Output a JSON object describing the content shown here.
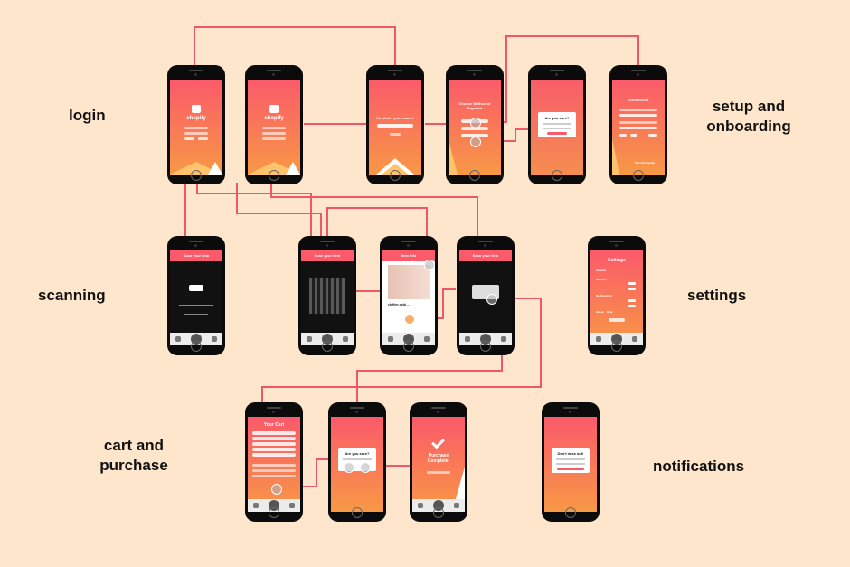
{
  "sections": {
    "login": "login",
    "setup_line1": "setup and",
    "setup_line2": "onboarding",
    "scanning": "scanning",
    "settings": "settings",
    "cart_line1": "cart and",
    "cart_line2": "purchase",
    "notifications": "notifications"
  },
  "screens": {
    "login1": {
      "brand": "shopify"
    },
    "login2": {
      "brand": "shopify"
    },
    "onboard_name": {
      "title": "Hi, what's your name?"
    },
    "onboard_payment": {
      "title": "Choose Method of Payment"
    },
    "onboard_confirm": {
      "title": "Are you sure?"
    },
    "onboard_card": {
      "title": "Credit/Debit",
      "cta": "Start Shopping!"
    },
    "scan1": {
      "title": "Scan your item"
    },
    "scan2": {
      "title": "Scan your item"
    },
    "item_info": {
      "title": "Item Info",
      "caption": "chiffon cold ..."
    },
    "scan3": {
      "title": "Scan your item"
    },
    "settings": {
      "title": "Settings",
      "rows": [
        "General",
        "Security",
        "Notifications",
        "About",
        "Help"
      ]
    },
    "cart": {
      "title": "Your Cart"
    },
    "cart_confirm": {
      "title": "Are you sure?"
    },
    "purchase_complete": {
      "title": "Purchase Complete!"
    },
    "notification": {
      "title": "Don't miss out!"
    }
  },
  "colors": {
    "accent": "#fb5a6a",
    "accent_end": "#f79845",
    "background": "#fde6cb",
    "connector": "#f0566a"
  }
}
